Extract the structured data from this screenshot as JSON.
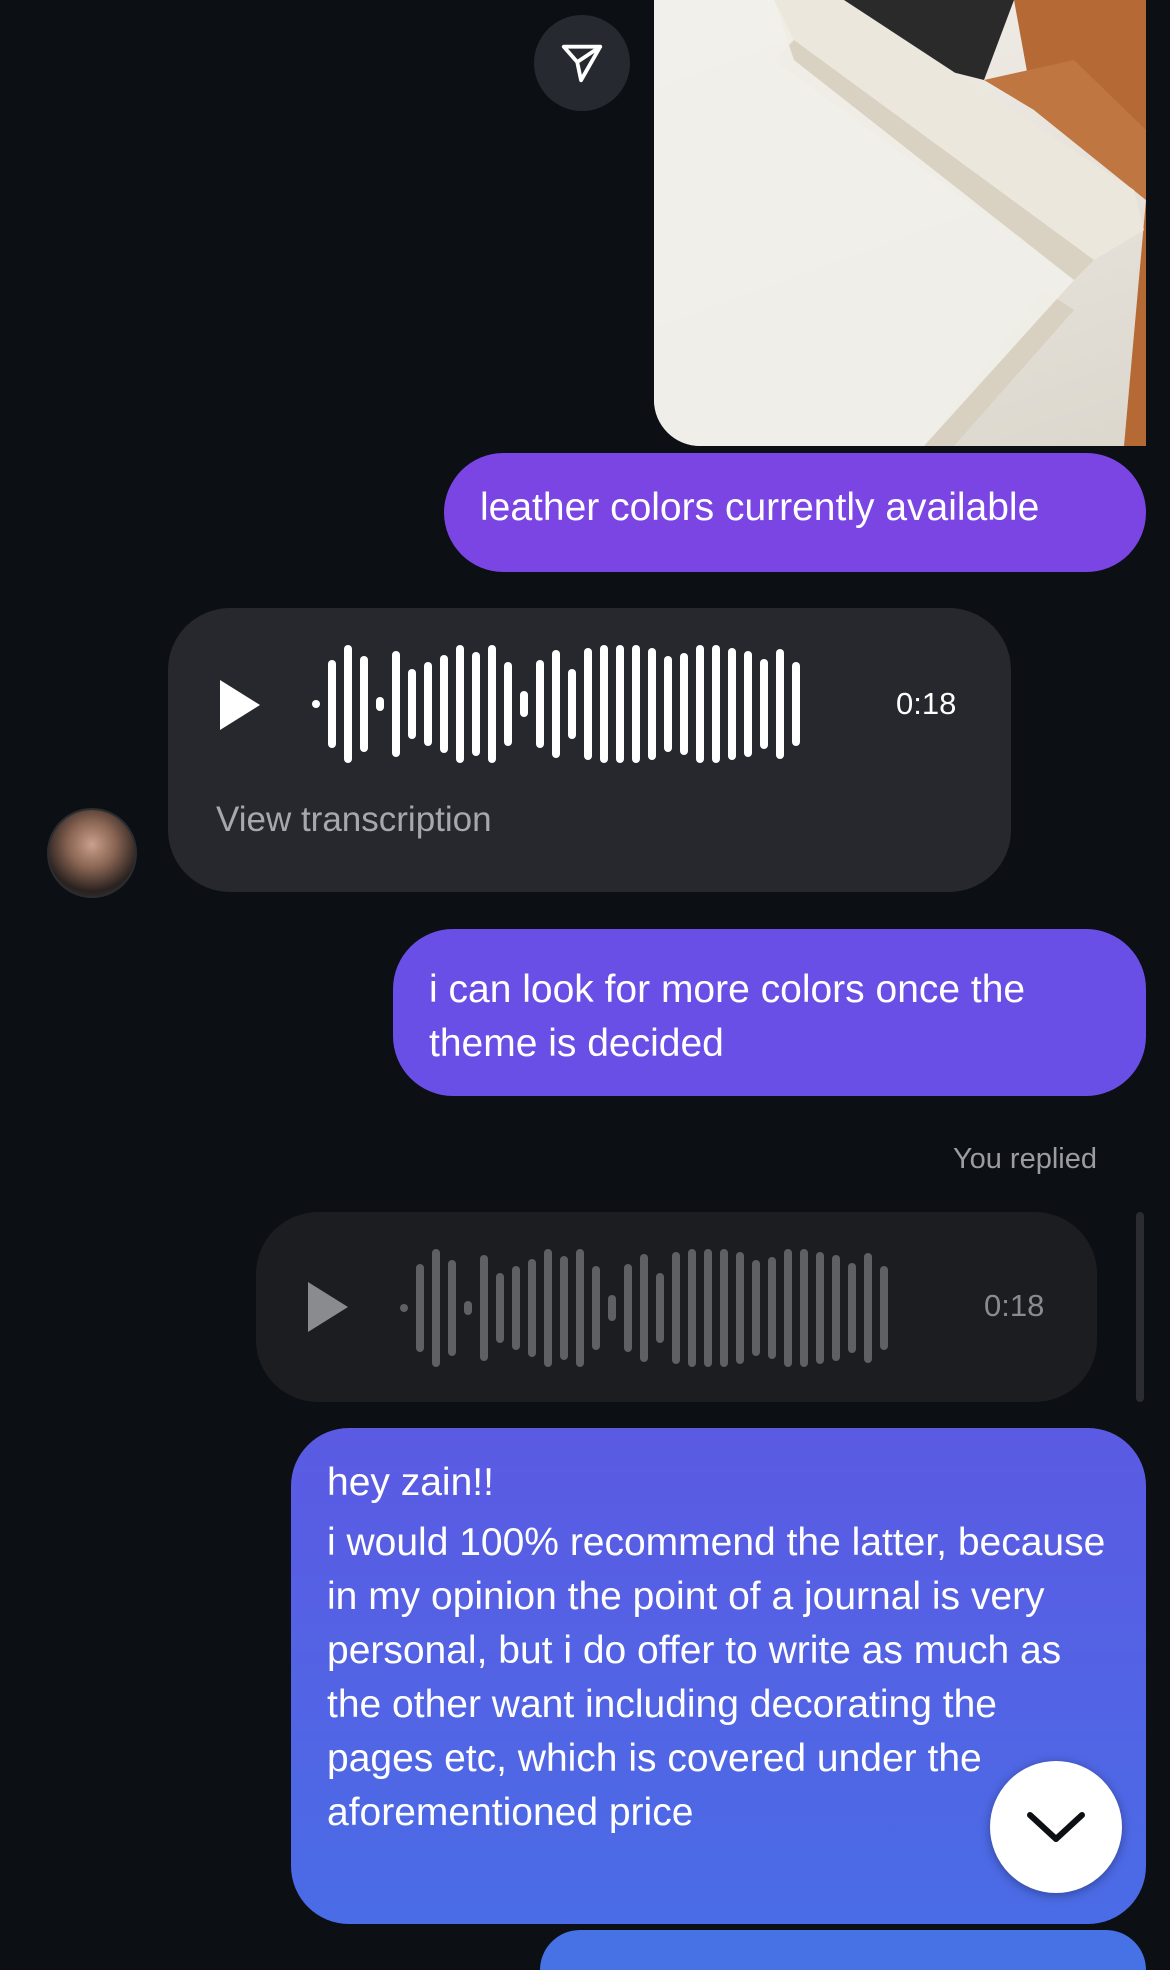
{
  "messages": {
    "m1_text": "leather colors currently available",
    "voice1": {
      "duration": "0:18",
      "transcription_link": "View transcription"
    },
    "m2_text": "i can look for more colors once the theme is decided",
    "reply_label": "You replied",
    "voice2": {
      "duration": "0:18"
    },
    "m3_greeting": "hey zain!!",
    "m3_body": "i would 100% recommend the latter, because in my opinion the point of a journal is very personal, but i do offer to write as much as the other want including decorating the pages etc, which is covered under the aforementioned price"
  },
  "icons": {
    "share": "send-icon",
    "play": "play-icon",
    "scroll_down": "chevron-down-icon"
  },
  "colors": {
    "background": "#0c0f14",
    "outgoing_purple": "#7a45e3",
    "outgoing_indigo": "#6a4fe6",
    "outgoing_blue": "#4a6ce6",
    "incoming_bubble": "#26282d"
  }
}
